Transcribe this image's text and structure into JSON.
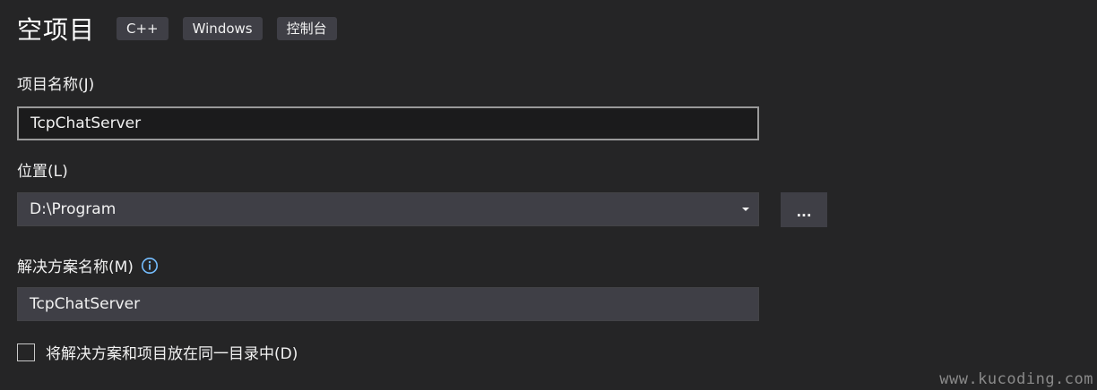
{
  "header": {
    "title": "空项目",
    "tags": [
      "C++",
      "Windows",
      "控制台"
    ]
  },
  "project_name": {
    "label": "项目名称(J)",
    "value": "TcpChatServer"
  },
  "location": {
    "label": "位置(L)",
    "value": "D:\\Program",
    "browse_label": "..."
  },
  "solution_name": {
    "label": "解决方案名称(M)",
    "value": "TcpChatServer"
  },
  "same_directory": {
    "label": "将解决方案和项目放在同一目录中(D)",
    "checked": false
  },
  "watermark": "www.kucoding.com",
  "colors": {
    "background": "#252526",
    "input": "#3f3f46",
    "info_icon": "#75beff"
  }
}
